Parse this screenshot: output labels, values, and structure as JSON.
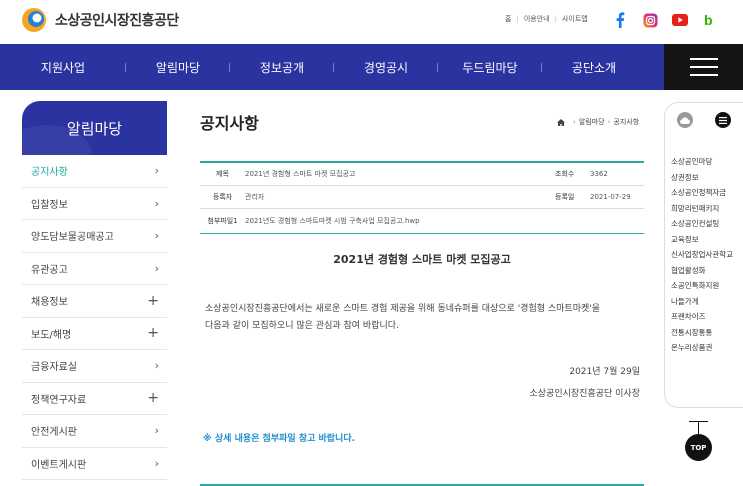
{
  "header": {
    "logo_text": "소상공인시장진흥공단",
    "util_links": [
      "홈",
      "이용안내",
      "사이트맵"
    ],
    "social": [
      "facebook-icon",
      "instagram-icon",
      "youtube-icon",
      "blog-icon"
    ],
    "colors": {
      "facebook": "#1877f2",
      "youtube": "#e62117",
      "blog": "#2db400"
    }
  },
  "nav": {
    "items": [
      "지원사업",
      "알림마당",
      "정보공개",
      "경영공시",
      "두드림마당",
      "공단소개"
    ],
    "bg": "#2b33a1"
  },
  "sidebar": {
    "title": "알림마당",
    "items": [
      {
        "label": "공지사항",
        "mark": "›",
        "active": true
      },
      {
        "label": "입찰정보",
        "mark": "›"
      },
      {
        "label": "양도담보물공매공고",
        "mark": "›"
      },
      {
        "label": "유관공고",
        "mark": "›"
      },
      {
        "label": "채용정보",
        "mark": "+"
      },
      {
        "label": "보도/해명",
        "mark": "+"
      },
      {
        "label": "금융자료실",
        "mark": "›"
      },
      {
        "label": "정책연구자료",
        "mark": "+"
      },
      {
        "label": "안전게시판",
        "mark": "›"
      },
      {
        "label": "이벤트게시판",
        "mark": "›"
      }
    ]
  },
  "main": {
    "page_title": "공지사항",
    "breadcrumb": [
      "알림마당",
      "공지사항"
    ],
    "info": {
      "title_key": "제목",
      "title_val": "2021년 경험형 스마트 마켓 모집공고",
      "views_key": "조회수",
      "views_val": "3362",
      "author_key": "등록자",
      "author_val": "관리자",
      "date_key": "등록일",
      "date_val": "2021-07-29",
      "attach_key": "첨부파일1",
      "attach_val": "2021년도 경험형 스마트마켓 시범 구축사업 모집공고.hwp"
    },
    "notice_title": "2021년 경험형 스마트 마켓 모집공고",
    "body_line1": "소상공인시장진흥공단에서는 새로운 스마트 경험 제공을 위해 동네슈퍼를 대상으로 '경험형 스마트마켓'을",
    "body_line2": "다음과 같이 모집하오니 많은 관심과 참여 바랍니다.",
    "date_line": "2021년 7월 29일",
    "org_line": "소상공인시장진흥공단 이사장",
    "note_line": "※ 상세 내용은 첨부파일 참고 바랍니다."
  },
  "quick": {
    "items": [
      "소상공인마당",
      "상권정보",
      "소상공인정책자금",
      "희망리턴패키지",
      "소상공인컨설팅",
      "교육정보",
      "신사업창업사관학교",
      "협업활성화",
      "소공인특화지원",
      "나들가게",
      "프랜차이즈",
      "전통시장통통",
      "온누리상품권"
    ],
    "top_label": "TOP"
  }
}
